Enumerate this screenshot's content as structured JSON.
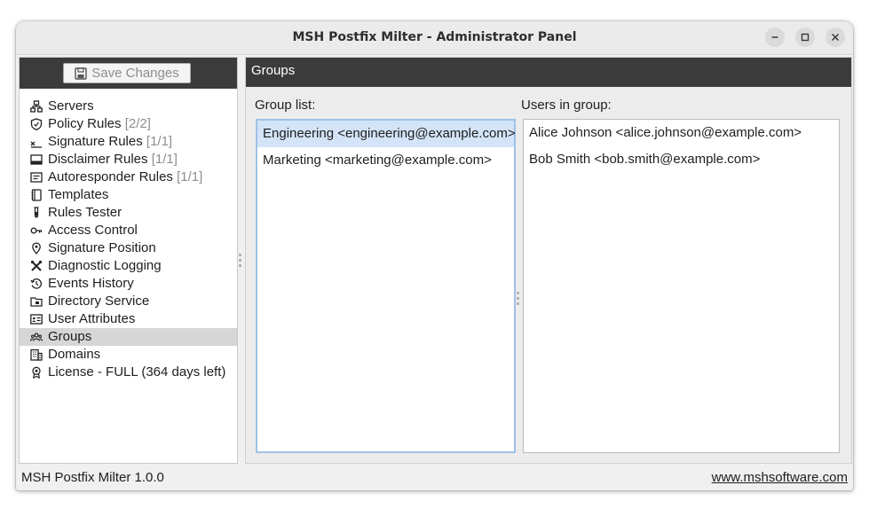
{
  "window": {
    "title": "MSH Postfix Milter - Administrator Panel"
  },
  "toolbar": {
    "save_label": "Save Changes"
  },
  "sidebar": {
    "items": [
      {
        "label": "Servers",
        "count": "",
        "icon": "servers-icon"
      },
      {
        "label": "Policy Rules",
        "count": "[2/2]",
        "icon": "shield-icon"
      },
      {
        "label": "Signature Rules",
        "count": "[1/1]",
        "icon": "signature-icon"
      },
      {
        "label": "Disclaimer Rules",
        "count": "[1/1]",
        "icon": "disclaimer-icon"
      },
      {
        "label": "Autoresponder Rules",
        "count": "[1/1]",
        "icon": "autoresponder-icon"
      },
      {
        "label": "Templates",
        "count": "",
        "icon": "templates-icon"
      },
      {
        "label": "Rules Tester",
        "count": "",
        "icon": "test-tube-icon"
      },
      {
        "label": "Access Control",
        "count": "",
        "icon": "key-icon"
      },
      {
        "label": "Signature Position",
        "count": "",
        "icon": "location-pin-icon"
      },
      {
        "label": "Diagnostic Logging",
        "count": "",
        "icon": "tools-icon"
      },
      {
        "label": "Events History",
        "count": "",
        "icon": "history-icon"
      },
      {
        "label": "Directory Service",
        "count": "",
        "icon": "folder-icon"
      },
      {
        "label": "User Attributes",
        "count": "",
        "icon": "id-card-icon"
      },
      {
        "label": "Groups",
        "count": "",
        "icon": "group-icon",
        "selected": true
      },
      {
        "label": "Domains",
        "count": "",
        "icon": "building-icon"
      },
      {
        "label": "License - FULL (364 days left)",
        "count": "",
        "icon": "license-badge-icon"
      }
    ]
  },
  "main": {
    "header": "Groups",
    "group_list_label": "Group list:",
    "users_label": "Users in group:",
    "groups": [
      {
        "text": "Engineering <engineering@example.com>",
        "selected": true
      },
      {
        "text": "Marketing <marketing@example.com>",
        "selected": false
      }
    ],
    "users": [
      {
        "text": "Alice Johnson <alice.johnson@example.com>"
      },
      {
        "text": "Bob Smith <bob.smith@example.com>"
      }
    ]
  },
  "status": {
    "version": "MSH Postfix Milter 1.0.0",
    "website": "www.mshsoftware.com"
  },
  "colors": {
    "header_bg": "#3b3b3b",
    "selection_bg": "#d3e4f8",
    "focus_border": "#9fc1e6",
    "sidebar_selected": "#d6d6d6"
  }
}
